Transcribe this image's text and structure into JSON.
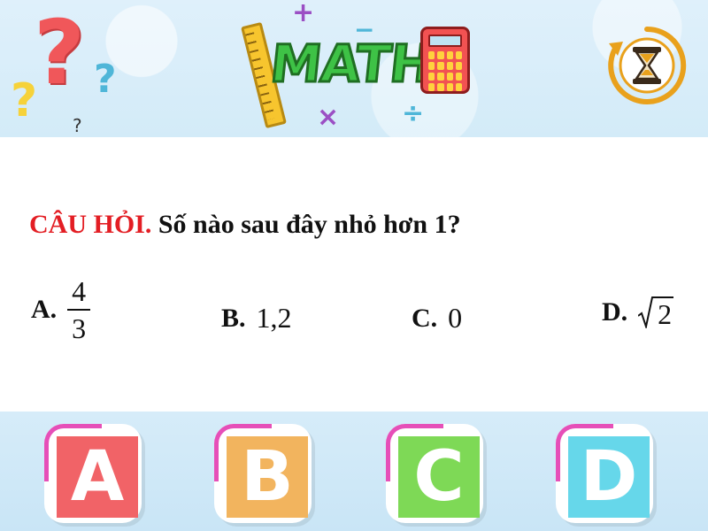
{
  "header": {
    "logo_text": "MATH",
    "decor_question_mark": "?",
    "math_symbols": {
      "plus": "+",
      "minus": "−",
      "times": "×",
      "divide": "÷"
    },
    "icons": {
      "logo": "math-logo-icon",
      "timer": "hourglass-timer-icon",
      "decor": "question-marks-icon"
    }
  },
  "question": {
    "label": "CÂU HỎI.",
    "text": "Số nào sau đây nhỏ hơn 1?"
  },
  "options": {
    "a": {
      "letter": "A.",
      "numerator": "4",
      "denominator": "3"
    },
    "b": {
      "letter": "B.",
      "value": "1,2"
    },
    "c": {
      "letter": "C.",
      "value": "0"
    },
    "d": {
      "letter": "D.",
      "radicand": "2"
    }
  },
  "answer_buttons": [
    "A",
    "B",
    "C",
    "D"
  ],
  "colors": {
    "question_label": "#e31e24",
    "tile_a": "#f16367",
    "tile_b": "#f2b45e",
    "tile_c": "#7ed956",
    "tile_d": "#66d7ea",
    "tile_accent": "#e64fb8",
    "band": "#d6ecf9"
  }
}
